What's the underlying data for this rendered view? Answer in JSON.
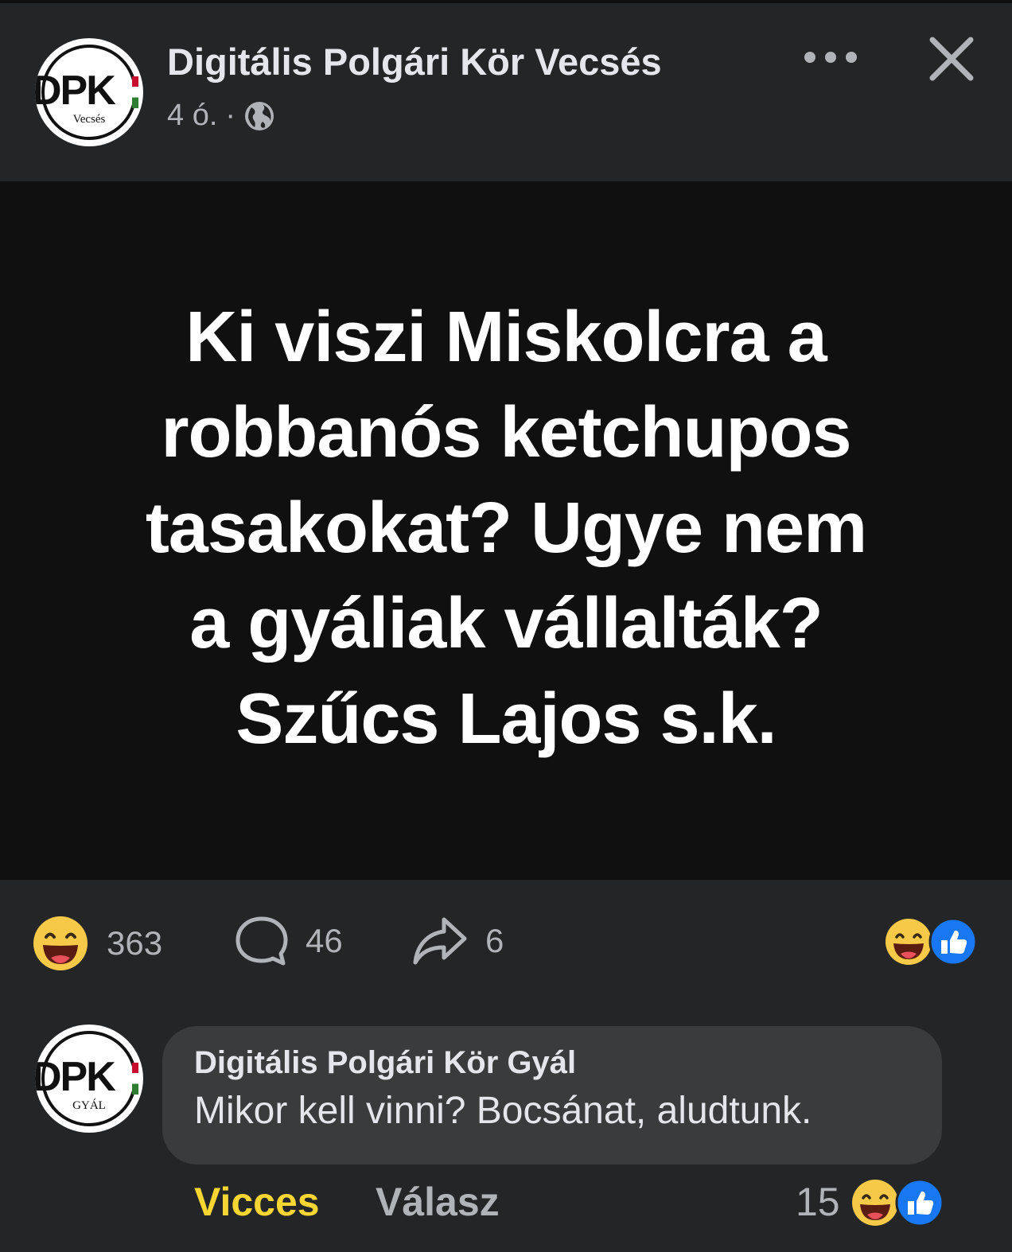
{
  "post": {
    "page_name": "Digitális Polgári Kör Vecsés",
    "avatar_brand": "DPK",
    "avatar_sub": "Vecsés",
    "time": "4 ó.",
    "separator": "·",
    "text_lines": [
      "Ki viszi Miskolcra a",
      "robbanós ketchupos",
      "tasakokat? Ugye nem",
      "a gyáliak vállalták?",
      "Szűcs Lajos s.k."
    ],
    "icons": [
      "globe-icon",
      "more-icon",
      "close-icon"
    ]
  },
  "stats": {
    "reactions": "363",
    "comments": "46",
    "shares": "6",
    "reaction_types": [
      "haha",
      "like"
    ]
  },
  "comment": {
    "author": "Digitális Polgári Kör Gyál",
    "avatar_brand": "DPK",
    "avatar_sub": "GYÁL",
    "text": "Mikor kell vinni? Bocsánat, aludtunk.",
    "reaction_label": "Vicces",
    "reply_label": "Válasz",
    "reaction_count": "15"
  },
  "colors": {
    "background": "#242527",
    "image_bg": "#101011",
    "bubble": "#3a3b3c",
    "text": "#e4e6eb",
    "secondary": "#b0b3b8",
    "vicces": "#f7d533",
    "like_blue": "#1877f2"
  }
}
